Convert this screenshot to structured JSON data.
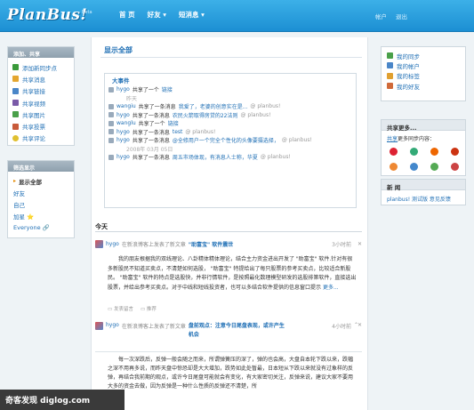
{
  "header": {
    "logo": "PlanBus!",
    "beta": "Beta",
    "nav": [
      "首 页",
      "好友 ▾",
      "短消息 ▾"
    ],
    "right": [
      "帐户",
      "退出"
    ]
  },
  "left_panel": {
    "title": "添加、共享",
    "items": [
      {
        "label": "添加新同步点",
        "icon": "add-sync-icon",
        "color": "#3a9a3a"
      },
      {
        "label": "共享消息",
        "icon": "message-icon",
        "color": "#e4a630"
      },
      {
        "label": "共享链接",
        "icon": "link-icon",
        "color": "#4a86c8"
      },
      {
        "label": "共享视频",
        "icon": "video-icon",
        "color": "#7a5aa8"
      },
      {
        "label": "共享图片",
        "icon": "image-icon",
        "color": "#4aa04a"
      },
      {
        "label": "共享投票",
        "icon": "vote-icon",
        "color": "#c85a3a"
      },
      {
        "label": "共享评论",
        "icon": "comment-icon",
        "color": "#e0c030"
      }
    ]
  },
  "filter_panel": {
    "title": "筛选显示",
    "items": [
      "显示全部",
      "好友",
      "自己",
      "加星 ⭐",
      "Everyone 🔗"
    ]
  },
  "main": {
    "title": "显示全部",
    "feed_title": "大事件",
    "feed": [
      {
        "user": "hygo",
        "text": "共享了一个",
        "link": "链接",
        "meta": ""
      },
      {
        "user": "",
        "text": "",
        "link": "",
        "meta": "昨天",
        "time": true
      },
      {
        "user": "wangiu",
        "text": "共享了一条消息",
        "link": "我爱了，老婆的创意实在是...",
        "meta": "@ planbus!"
      },
      {
        "user": "hygo",
        "text": "共享了一条消息",
        "link": "农民火箭取得房贷的22法则",
        "meta": "@ planbus!"
      },
      {
        "user": "wanglu",
        "text": "共享了一个",
        "link": "链接",
        "meta": ""
      },
      {
        "user": "hygo",
        "text": "共享了一条消息",
        "link": "test",
        "meta": "@ planbus!"
      },
      {
        "user": "hygo",
        "text": "共享了一条消息",
        "link": "@全修用户一个完全个性化的头像要摄选择，",
        "meta": "@ planbus!"
      },
      {
        "user": "",
        "text": "",
        "link": "",
        "meta": "2008年 03月 05日",
        "time": true
      },
      {
        "user": "hygo",
        "text": "共享了一条消息",
        "link": "周五市场体现，有消息人士称，华夏",
        "meta": "@ planbus!"
      }
    ],
    "today_label": "今天",
    "posts": [
      {
        "user": "hygo",
        "source": "在新浪博客上发表了新文章",
        "doc": "\"助富宝\" 软件震世",
        "time": "3小时前",
        "body": "我的朋友根据我的双线理论、八卦精体精体理论，结合主力资金进出开发了 \"助富宝\" 软件.针对有很多新股民不知道买卖点，不清楚如何选股， \"助富宝\" 特提给出了每只股票的参考买卖点，比较适合新股民。 \"助富宝\" 软件的特点是选股快，并非行情软件，是按照最化数理模型研发的选股排第软件，直接选出股票，并给出参考买卖点。对于中线和短线投资者，也可以多结合软件提供的信息窗口提示",
        "more": "更多...",
        "actions": [
          "发表留言",
          "推荐"
        ]
      },
      {
        "user": "hygo",
        "source": "在新浪博客上发表了新文章",
        "doc": "盘前观点：注意今日尾盘表现，或许产生机会",
        "time": "4小时前",
        "body": "每一次深跌后，反弹一般会随之而来，所谓弹簧压的深了，弹的也会高，大盘自本轮下跌以来，跌幅之深不用再多说，而昨天盘中惊恐却是大大增加，跌势如此处暂最，日本短从下跌以来就没有过象样的反弹，再结合我前期的观点，或许今日尾盘可能就会有变化，有大家密切关注，反弹来说，建议大家不要用大多的资金去做，因为反弹是一种什么性质的反弹还不清楚，所"
      }
    ]
  },
  "right_panel": {
    "items": [
      {
        "label": "我的同步",
        "icon": "sync-icon",
        "color": "#4aa04a"
      },
      {
        "label": "我的帐户",
        "icon": "account-icon",
        "color": "#4a86c8"
      },
      {
        "label": "我的标签",
        "icon": "tag-icon",
        "color": "#e0a030"
      },
      {
        "label": "我的好友",
        "icon": "friends-icon",
        "color": "#d06a3a"
      }
    ],
    "share_title": "共享更多...",
    "share_text_link": "共享",
    "share_text": "更多同步内容：",
    "share_icons": [
      "#d23",
      "#3a7",
      "#e60",
      "#c31",
      "#e83",
      "#48c",
      "#5a5",
      "#c44"
    ],
    "news_title": "新 闻",
    "news_text": "planbus! 测试版 意见反馈"
  },
  "watermark": "奇客发现 diglog.com"
}
